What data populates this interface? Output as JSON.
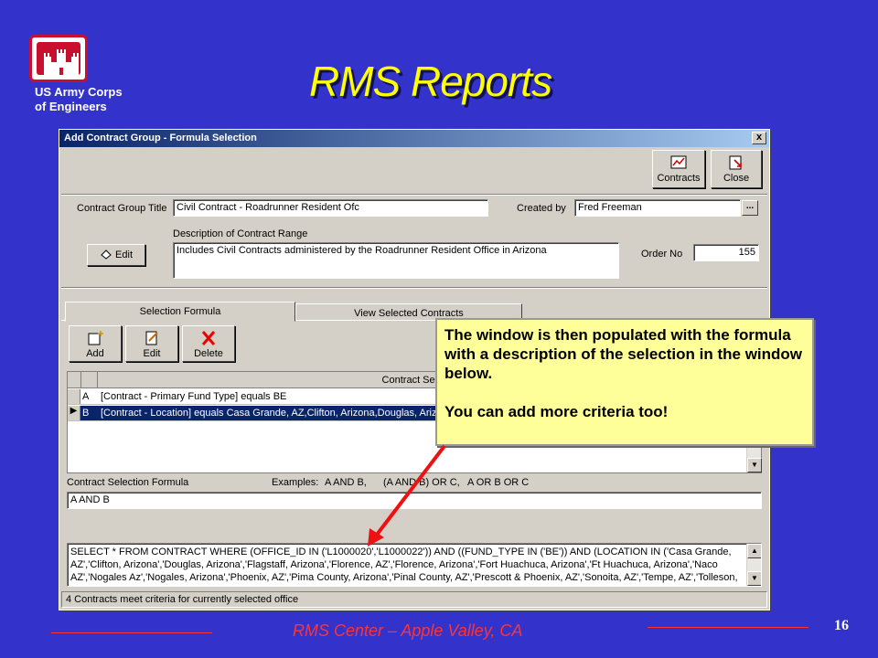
{
  "slide": {
    "title": "RMS Reports",
    "org_line1": "US Army Corps",
    "org_line2": "of Engineers",
    "footer": "RMS Center – Apple Valley, CA",
    "page_number": "16"
  },
  "dialog": {
    "title": "Add Contract Group - Formula Selection",
    "close_glyph": "x",
    "toolbar": {
      "contracts_label": "Contracts",
      "close_label": "Close"
    },
    "group_title_label": "Contract Group Title",
    "group_title_value": "Civil Contract - Roadrunner Resident Ofc",
    "created_by_label": "Created by",
    "created_by_value": "Fred Freeman",
    "ellipsis": "...",
    "description_label": "Description of Contract Range",
    "description_value": "Includes Civil Contracts administered by the Roadrunner Resident Office in Arizona",
    "edit_button": "Edit",
    "order_no_label": "Order No",
    "order_no_value": "155",
    "tabs": [
      "Selection Formula",
      "View Selected Contracts"
    ],
    "formula_buttons": {
      "add": "Add",
      "edit": "Edit",
      "delete": "Delete"
    },
    "grid": {
      "header": "Contract Selection",
      "rows": [
        {
          "id": "A",
          "text": "[Contract - Primary Fund Type]  equals BE"
        },
        {
          "id": "B",
          "text": "[Contract - Location]  equals Casa Grande, AZ,Clifton, Arizona,Douglas, Arizona"
        }
      ]
    },
    "formula_label": "Contract Selection Formula",
    "examples_label": "Examples:",
    "examples": [
      "A AND B,",
      "(A AND B) OR C,",
      "A OR B OR C"
    ],
    "formula_value": "A AND B",
    "sql_lines": [
      "SELECT * FROM CONTRACT WHERE (OFFICE_ID  IN ('L1000020','L1000022')) AND ((FUND_TYPE  IN ('BE')) AND (LOCATION  IN ('Casa Grande,",
      "AZ','Clifton, Arizona','Douglas, Arizona','Flagstaff, Arizona','Florence, AZ','Florence, Arizona','Fort Huachuca, Arizona','Ft Huachuca, Arizona','Naco",
      "AZ','Nogales Az','Nogales, Arizona','Phoenix, AZ','Pima County, Arizona','Pinal County, AZ','Prescott & Phoenix, AZ','Sonoita, AZ','Tempe, AZ','Tolleson,"
    ],
    "status": "4 Contracts meet criteria for currently selected office"
  },
  "callout": {
    "line1": "The window is then populated with the formula with a description of the selection in the window below.",
    "line2": "You can add more criteria too!"
  },
  "colors": {
    "background": "#3333cc",
    "title": "#ffff00",
    "accent": "#ff3333",
    "callout": "#ffff99"
  }
}
